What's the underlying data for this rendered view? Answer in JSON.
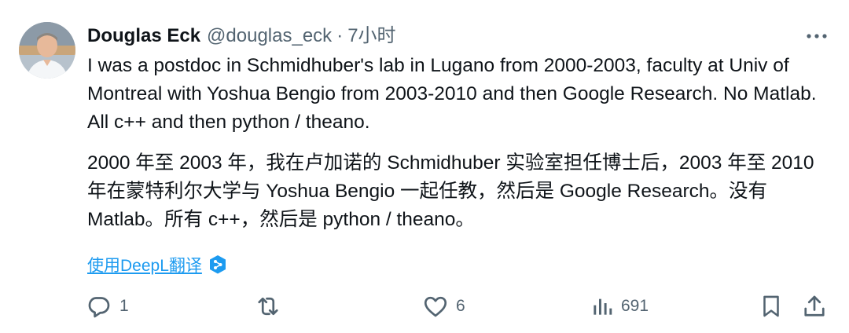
{
  "tweet": {
    "author_name": "Douglas Eck",
    "handle": "@douglas_eck",
    "separator": "·",
    "time": "7小时",
    "text_en": "I was a postdoc in Schmidhuber's lab in Lugano from 2000-2003,  faculty at Univ of Montreal with Yoshua Bengio from 2003-2010 and then Google Research. No Matlab. All c++ and then python / theano.",
    "text_zh": "2000 年至 2003 年，我在卢加诺的 Schmidhuber 实验室担任博士后，2003 年至 2010 年在蒙特利尔大学与 Yoshua Bengio 一起任教，然后是 Google Research。没有Matlab。所有 c++，然后是 python / theano。",
    "translate_label": "使用DeepL翻译"
  },
  "actions": {
    "reply_count": "1",
    "like_count": "6",
    "view_count": "691"
  },
  "icons": {
    "avatar": "avatar",
    "more": "more-icon",
    "deepl": "deepl-icon",
    "reply": "reply-icon",
    "retweet": "retweet-icon",
    "like": "like-icon",
    "views": "views-icon",
    "bookmark": "bookmark-icon",
    "share": "share-icon"
  },
  "colors": {
    "text": "#0f1419",
    "secondary": "#536471",
    "link": "#1d9bf0",
    "deepl": "#0f2b46"
  }
}
